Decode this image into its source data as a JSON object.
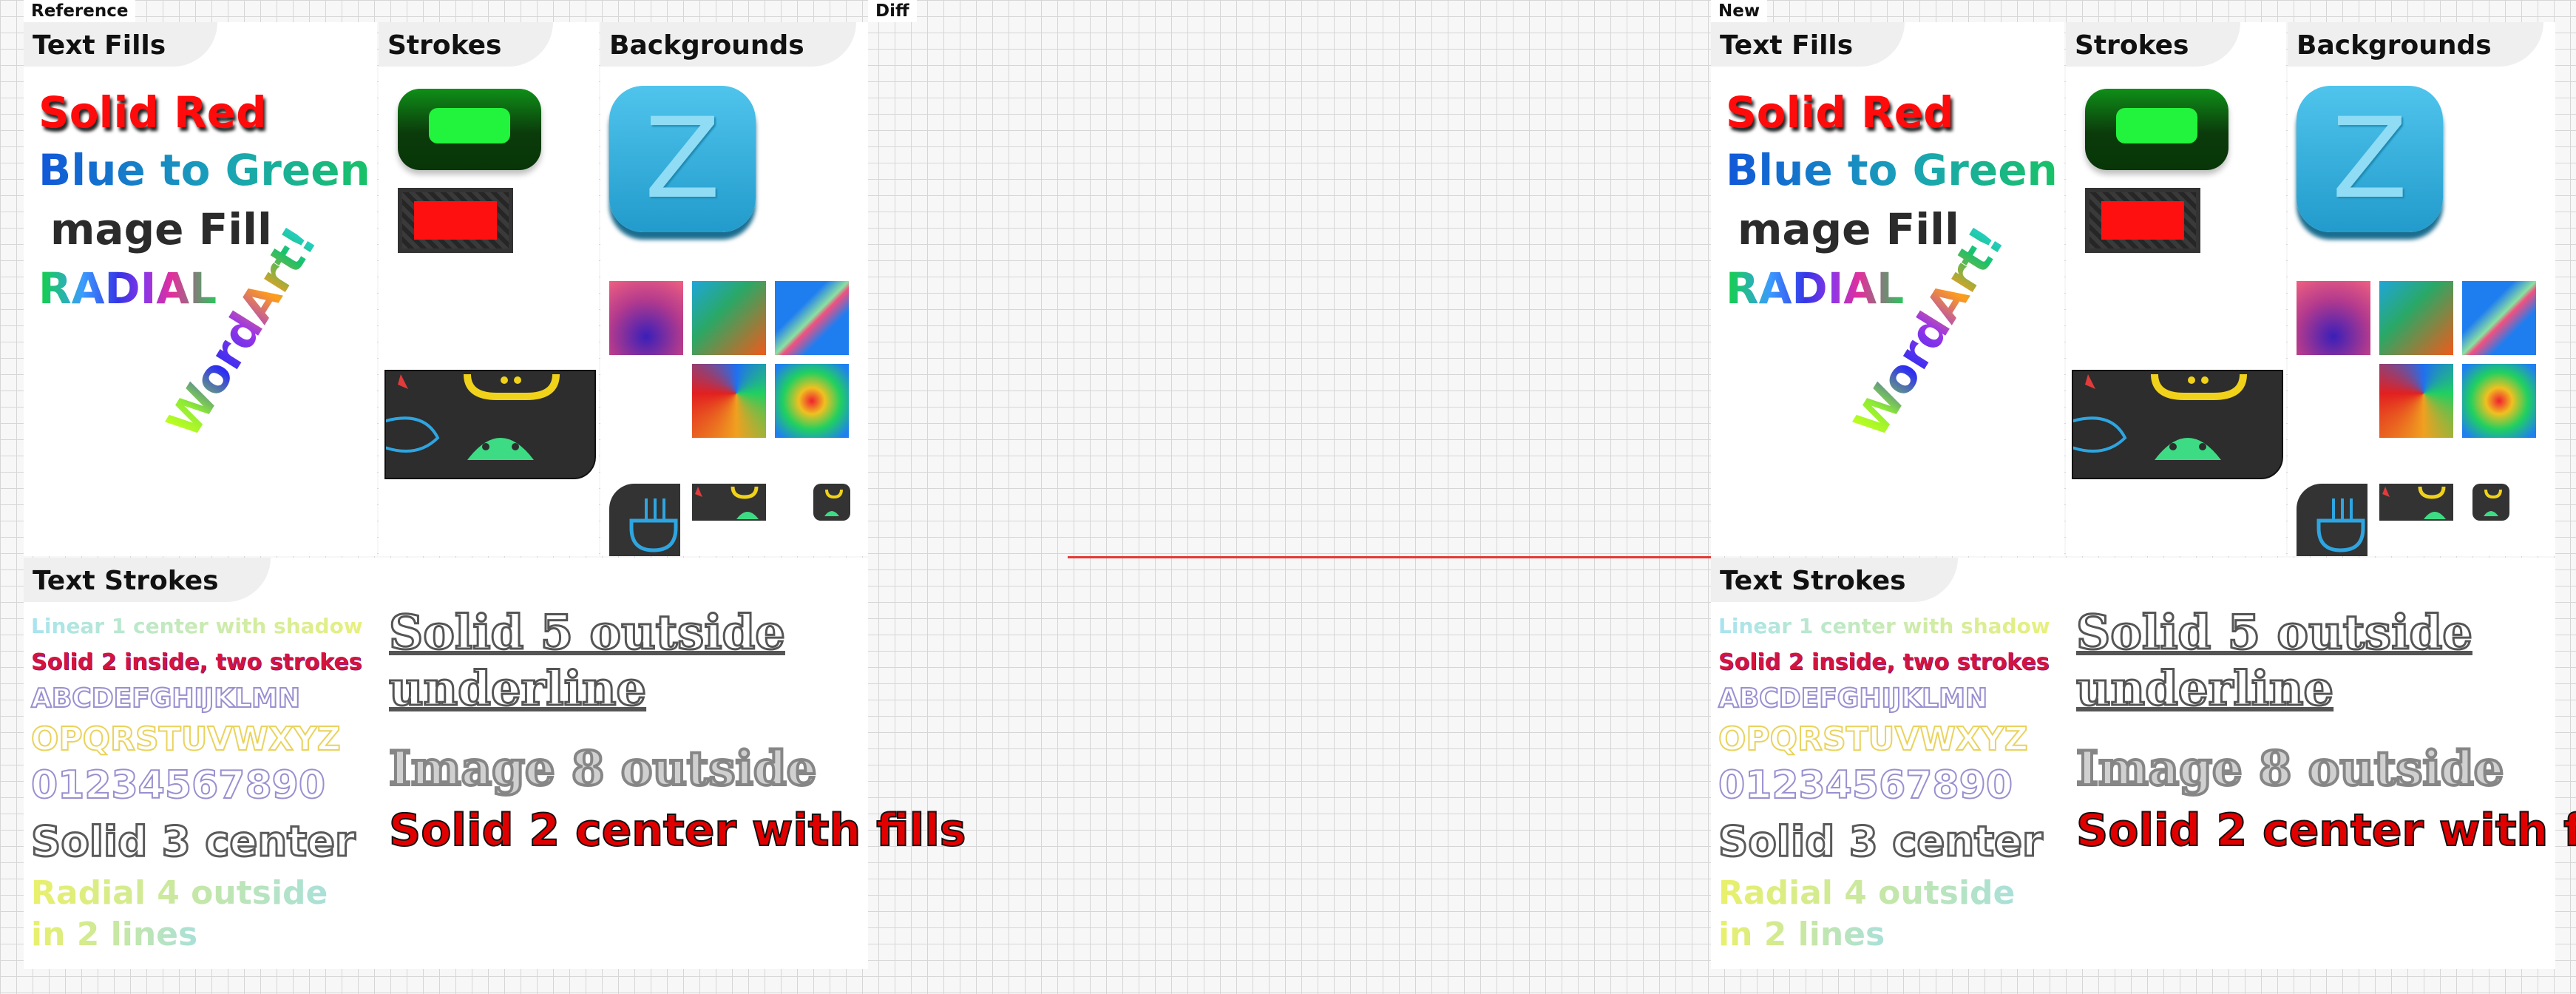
{
  "labels": {
    "reference": "Reference",
    "diff": "Diff",
    "new": "New"
  },
  "sections": {
    "text_fills": "Text Fills",
    "strokes": "Strokes",
    "backgrounds": "Backgrounds",
    "text_strokes": "Text Strokes"
  },
  "text_fills": {
    "solid_red": "Solid Red",
    "blue_green": "Blue to Green",
    "image_fill": "mage Fill",
    "radial": "RADIAL",
    "wordart": "WordArt!"
  },
  "backgrounds": {
    "icon_letter": "Z"
  },
  "text_strokes": {
    "linear1": "Linear 1 center with shadow",
    "solid2": "Solid 2 inside, two strokes",
    "letters1": "ABCDEFGHIJKLMN",
    "letters2": "OPQRSTUVWXYZ",
    "digits": "01234567890",
    "solid3": "Solid 3 center",
    "radial4_l1": "Radial 4 outside",
    "radial4_l2": "in 2 lines",
    "solid5_l1": "Solid 5 outside",
    "solid5_l2": "underline",
    "image8": "Image 8 outside",
    "solid2fill": "Solid 2 center with fills"
  },
  "colors": {
    "diff_line": "#e13a3a",
    "solid_red": "#ff0b0b",
    "stroke_green": "#10e022",
    "icon_blue": "#2eaed6"
  }
}
